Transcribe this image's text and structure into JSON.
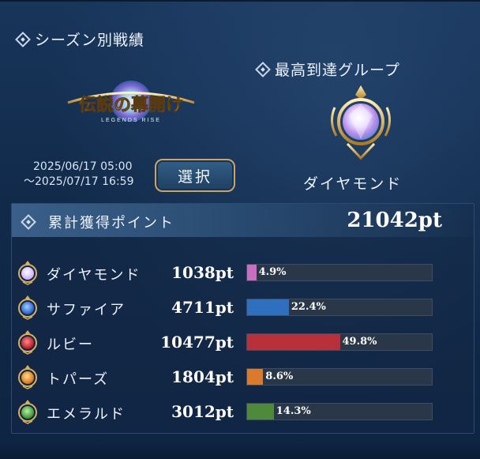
{
  "section": {
    "title": "シーズン別戦績"
  },
  "season": {
    "logo_text": "伝説の幕開け",
    "logo_subtext": "LEGENDS RISE",
    "start": "2025/06/17 05:00",
    "end": "〜2025/07/17 16:59",
    "select_label": "選択"
  },
  "best_group": {
    "title": "最高到達グループ",
    "name": "ダイヤモンド"
  },
  "points": {
    "label": "累計獲得ポイント",
    "total": "21042pt",
    "rows": [
      {
        "name": "ダイヤモンド",
        "points": "1038pt",
        "percent_label": "4.9%",
        "share": 4.9,
        "color": "#c86fc0",
        "icon": "diamond-gem-icon"
      },
      {
        "name": "サファイア",
        "points": "4711pt",
        "percent_label": "22.4%",
        "share": 22.4,
        "color": "#2f6fc0",
        "icon": "sapphire-gem-icon"
      },
      {
        "name": "ルビー",
        "points": "10477pt",
        "percent_label": "49.8%",
        "share": 49.8,
        "color": "#b8313a",
        "icon": "ruby-gem-icon"
      },
      {
        "name": "トパーズ",
        "points": "1804pt",
        "percent_label": "8.6%",
        "share": 8.6,
        "color": "#d97a2c",
        "icon": "topaz-gem-icon"
      },
      {
        "name": "エメラルド",
        "points": "3012pt",
        "percent_label": "14.3%",
        "share": 14.3,
        "color": "#4f8a3a",
        "icon": "emerald-gem-icon"
      }
    ]
  }
}
